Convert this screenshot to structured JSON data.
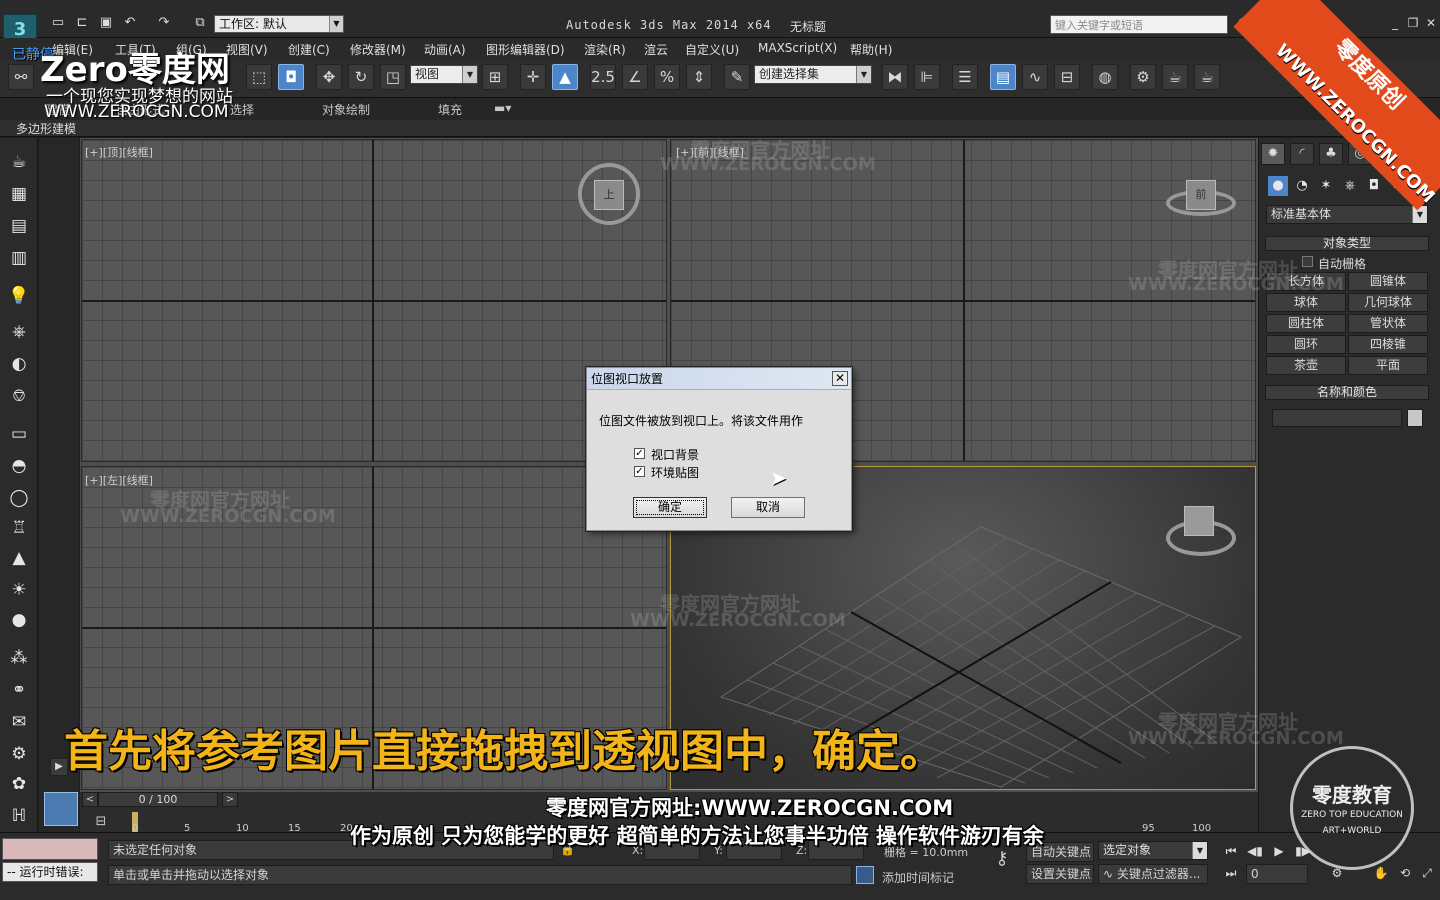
{
  "app": {
    "title": "Autodesk 3ds Max  2014 x64",
    "document": "无标题",
    "workspace_label": "工作区: 默认",
    "search_placeholder": "键入关键字或短语"
  },
  "menu": [
    "编辑(E)",
    "工具(T)",
    "组(G)",
    "视图(V)",
    "创建(C)",
    "修改器(M)",
    "动画(A)",
    "图形编辑器(D)",
    "渲染(R)",
    "渲云",
    "自定义(U)",
    "MAXScript(X)",
    "帮助(H)"
  ],
  "toolbar": {
    "view_combo": "视图",
    "selection_set_combo": "创建选择集",
    "snap_angle_label": "2.5"
  },
  "ribbon": {
    "tabs": [
      "建模",
      "自由形式",
      "选择",
      "对象绘制",
      "填充"
    ],
    "sub_label": "多边形建模"
  },
  "viewports": {
    "top_label": "[+][顶][线框]",
    "front_label": "[+][前][线框]",
    "left_label": "[+][左][线框]",
    "top_cube": "上",
    "front_cube": "前"
  },
  "command_panel": {
    "category_combo": "标准基本体",
    "object_type_header": "对象类型",
    "autogrid_label": "自动栅格",
    "object_buttons": [
      "长方体",
      "圆锥体",
      "球体",
      "几何球体",
      "圆柱体",
      "管状体",
      "圆环",
      "四棱锥",
      "茶壶",
      "平面"
    ],
    "name_color_header": "名称和颜色"
  },
  "timeline": {
    "frame_display": "0 / 100",
    "ticks": [
      "0",
      "5",
      "10",
      "15",
      "20",
      "95",
      "100"
    ]
  },
  "status": {
    "runtime_error_label": "运行时错误:",
    "selection_status": "未选定任何对象",
    "prompt": "单击或单击并拖动以选择对象",
    "x_label": "X:",
    "y_label": "Y:",
    "z_label": "Z:",
    "grid_text": "栅格 = 10.0mm",
    "add_time_tag": "添加时间标记",
    "auto_key": "自动关键点",
    "set_key": "设置关键点",
    "key_target_combo": "选定对象",
    "key_filters": "关键点过滤器...",
    "frame_input": "0"
  },
  "dialog": {
    "title": "位图视口放置",
    "message": "位图文件被放到视口上。将该文件用作",
    "options": [
      {
        "label": "视口背景",
        "checked": true
      },
      {
        "label": "环境贴图",
        "checked": true
      }
    ],
    "ok": "确定",
    "cancel": "取消"
  },
  "overlay": {
    "subtitle": "首先将参考图片直接拖拽到透视图中，确定。",
    "site_caption": "零度网官方网址:WWW.ZEROCGN.COM",
    "slogan": "作为原创 只为您能学的更好 超简单的方法让您事半功倍 操作软件游刃有余",
    "brand_logo": "Zero零度网",
    "brand_tagline": "一个现您实现梦想的网站",
    "brand_url": "WWW.ZEROCGN.COM",
    "brand_prefix": "已静停",
    "corner_banner": "零度原创",
    "corner_url": "WWW.ZEROCGN.COM",
    "watermark_title": "零度网官方网址",
    "watermark_url": "WWW.ZEROCGN.COM",
    "seal_title": "零度教育",
    "seal_sub": "ZERO TOP EDUCATION",
    "seal_mark": "ART+WORLD"
  },
  "colors": {
    "accent_blue": "#4c86c8",
    "active_viewport_border": "#b59a3a",
    "subtitle_yellow": "#f2b418",
    "banner_orange": "#e24a1b"
  }
}
